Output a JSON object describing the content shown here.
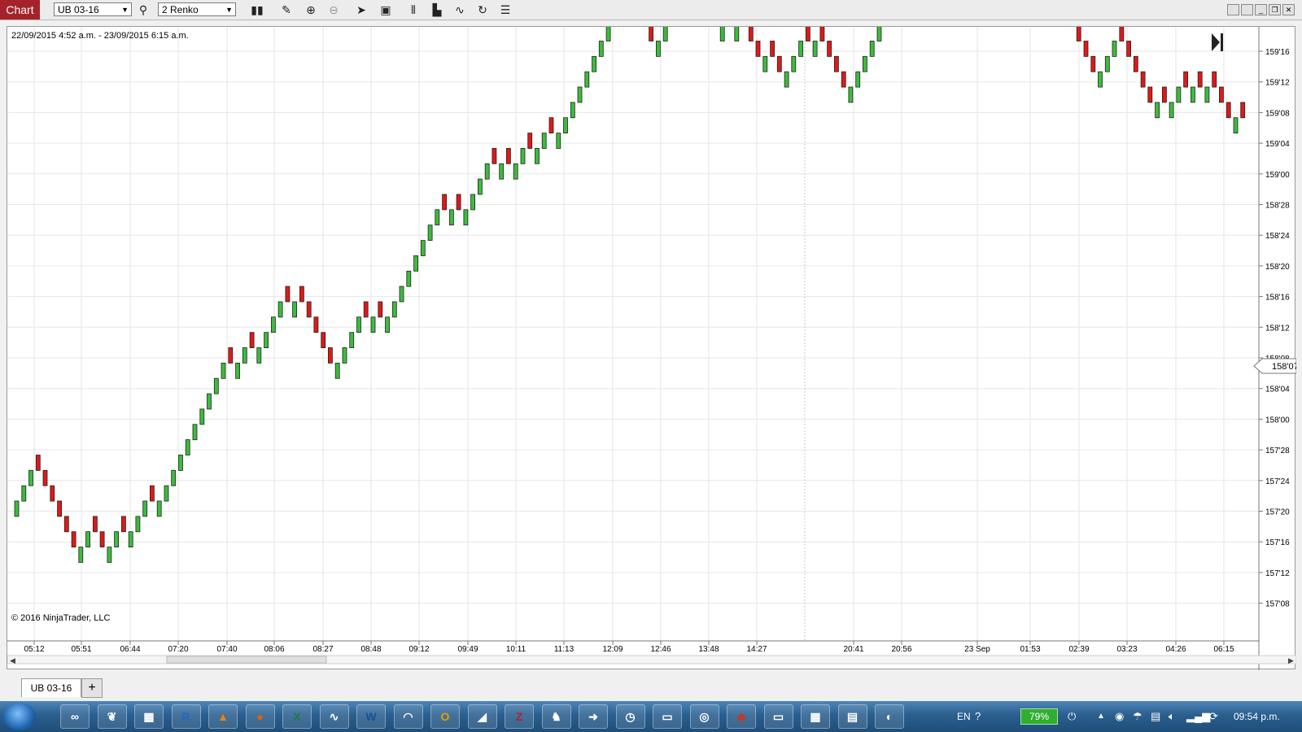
{
  "toolbar": {
    "chart_tab": "Chart",
    "instrument": "UB 03-16",
    "period": "2 Renko",
    "icons": [
      "bar-type-icon",
      "draw-pencil-icon",
      "zoom-in-icon",
      "zoom-out-icon",
      "pointer-icon",
      "data-box-icon",
      "bar-spacing-icon",
      "chart-style-icon",
      "drawing-tools-icon",
      "reload-icon",
      "properties-list-icon"
    ]
  },
  "window_controls": [
    "tile-icon",
    "tile-2-icon",
    "minimize-icon",
    "restore-icon",
    "close-icon"
  ],
  "chart": {
    "date_range": "22/09/2015 4:52 a.m. - 23/09/2015 6:15 a.m.",
    "copyright": "© 2016 NinjaTrader, LLC",
    "price_labels": [
      "159'16",
      "159'12",
      "159'08",
      "159'04",
      "159'00",
      "158'28",
      "158'24",
      "158'20",
      "158'16",
      "158'12",
      "158'08",
      "158'04",
      "158'00",
      "157'28",
      "157'24",
      "157'20",
      "157'16",
      "157'12",
      "157'08"
    ],
    "current_price": "158'07",
    "time_labels": [
      "05:12",
      "05:51",
      "06:44",
      "07:20",
      "07:40",
      "08:06",
      "08:27",
      "08:48",
      "09:12",
      "09:49",
      "10:11",
      "11:13",
      "12:09",
      "12:46",
      "13:48",
      "14:27",
      "20:41",
      "20:56",
      "23 Sep",
      "01:53",
      "02:39",
      "03:23",
      "04:26",
      "06:15"
    ],
    "colors": {
      "up": "#3cbc3c",
      "down": "#e01818",
      "grid": "#e6e6e6"
    }
  },
  "chart_data": {
    "type": "renko",
    "brick_size": "2 ticks (2/32)",
    "title": "UB 03-16",
    "y_unit": "price in 32nds",
    "ylim": [
      "157'06",
      "159'18"
    ],
    "last_price": "158'07",
    "direction_sequence": "UUUDDDDDDUUDDUUDUUUDUUUUUUUUUUDUUDUUUUDUDDDDDUUUUDUDUUUUUUUUDUDUUUUDUDUUDUUDUUUUUUUUUUDDDDUUUUUDDDDUDUDDDUDDUUUDUDDDDUUUUUUUUUUUUUUUDDDDUUDUDDDDDDDDDDDDUUUDDDDDUDUUDUDUDDDUD"
  },
  "bottom": {
    "tab_label": "UB 03-16",
    "add_label": "+"
  },
  "taskbar": {
    "apps": [
      "infinity-icon",
      "leaf-icon",
      "scanner-icon",
      "r-icon",
      "vlc-icon",
      "firefox-icon",
      "excel-icon",
      "swirl-icon",
      "word-icon",
      "headset-icon",
      "outlook-icon",
      "chart-app-icon",
      "filezilla-icon",
      "runner-icon",
      "arrow-icon",
      "clock-icon",
      "folder-icon",
      "camera-icon",
      "pdf-icon",
      "monitor-icon",
      "calculator-icon",
      "notes-icon",
      "panda-icon"
    ],
    "lang": "EN",
    "battery": "79%",
    "clock": "09:54 p.m."
  }
}
